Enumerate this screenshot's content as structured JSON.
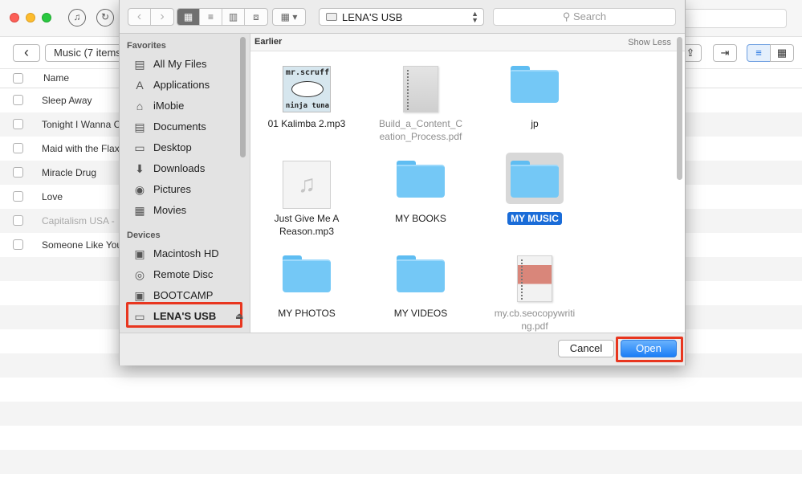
{
  "app": {
    "breadcrumb": "Music (7 items",
    "column_name": "Name",
    "rows": [
      {
        "title": "Sleep Away",
        "dim": false
      },
      {
        "title": "Tonight I Wanna C",
        "dim": false
      },
      {
        "title": "Maid with the Flax",
        "dim": false
      },
      {
        "title": "Miracle Drug",
        "dim": false
      },
      {
        "title": "Love",
        "dim": false
      },
      {
        "title": "Capitalism USA -",
        "dim": true
      },
      {
        "title": "Someone Like You",
        "dim": false
      }
    ],
    "icons": {
      "music": "♫",
      "sync": "↻",
      "back": "‹",
      "list_view": "≡",
      "grid_view": "▦"
    }
  },
  "dialog": {
    "location": "LENA'S USB",
    "search_placeholder": "Search",
    "view_icons": {
      "back": "‹",
      "forward": "›",
      "icon": "▦",
      "list": "≡",
      "columns": "▥",
      "coverflow": "⧈",
      "arrange": "▦ ▾"
    },
    "sidebar": {
      "favorites_heading": "Favorites",
      "favorites": [
        {
          "label": "All My Files",
          "icon": "files-icon",
          "glyph": "▤"
        },
        {
          "label": "Applications",
          "icon": "applications-icon",
          "glyph": "A"
        },
        {
          "label": "iMobie",
          "icon": "home-icon",
          "glyph": "⌂"
        },
        {
          "label": "Documents",
          "icon": "documents-icon",
          "glyph": "▤"
        },
        {
          "label": "Desktop",
          "icon": "desktop-icon",
          "glyph": "▭"
        },
        {
          "label": "Downloads",
          "icon": "downloads-icon",
          "glyph": "⬇"
        },
        {
          "label": "Pictures",
          "icon": "camera-icon",
          "glyph": "◉"
        },
        {
          "label": "Movies",
          "icon": "film-icon",
          "glyph": "▦"
        }
      ],
      "devices_heading": "Devices",
      "devices": [
        {
          "label": "Macintosh HD",
          "icon": "hard-drive-icon",
          "glyph": "▣"
        },
        {
          "label": "Remote Disc",
          "icon": "disc-icon",
          "glyph": "◎"
        },
        {
          "label": "BOOTCAMP",
          "icon": "hard-drive-icon",
          "glyph": "▣"
        },
        {
          "label": "LENA'S USB",
          "icon": "usb-drive-icon",
          "glyph": "▭",
          "selected": true
        }
      ],
      "eject_glyph": "⏏"
    },
    "section": {
      "title": "Earlier",
      "toggle": "Show Less"
    },
    "files": [
      {
        "label": "01 Kalimba 2.mp3",
        "kind": "album",
        "art_top": "mr.scruff",
        "art_bottom": "ninja tuna"
      },
      {
        "label": "Build_a_Content_C eation_Process.pdf",
        "kind": "pdf",
        "dim": true
      },
      {
        "label": "jp",
        "kind": "folder"
      },
      {
        "label": "Just Give Me A Reason.mp3",
        "kind": "audio",
        "glyph": "♫"
      },
      {
        "label": "MY BOOKS",
        "kind": "folder"
      },
      {
        "label": "MY MUSIC",
        "kind": "folder",
        "selected": true
      },
      {
        "label": "MY PHOTOS",
        "kind": "folder"
      },
      {
        "label": "MY VIDEOS",
        "kind": "folder"
      },
      {
        "label": "my.cb.seocopywriti ng.pdf",
        "kind": "pdf-red",
        "dim": true
      }
    ],
    "buttons": {
      "cancel": "Cancel",
      "open": "Open"
    }
  },
  "colors": {
    "accent": "#1b7ef6",
    "highlight": "#e8361f",
    "folder": "#74c8f6"
  }
}
